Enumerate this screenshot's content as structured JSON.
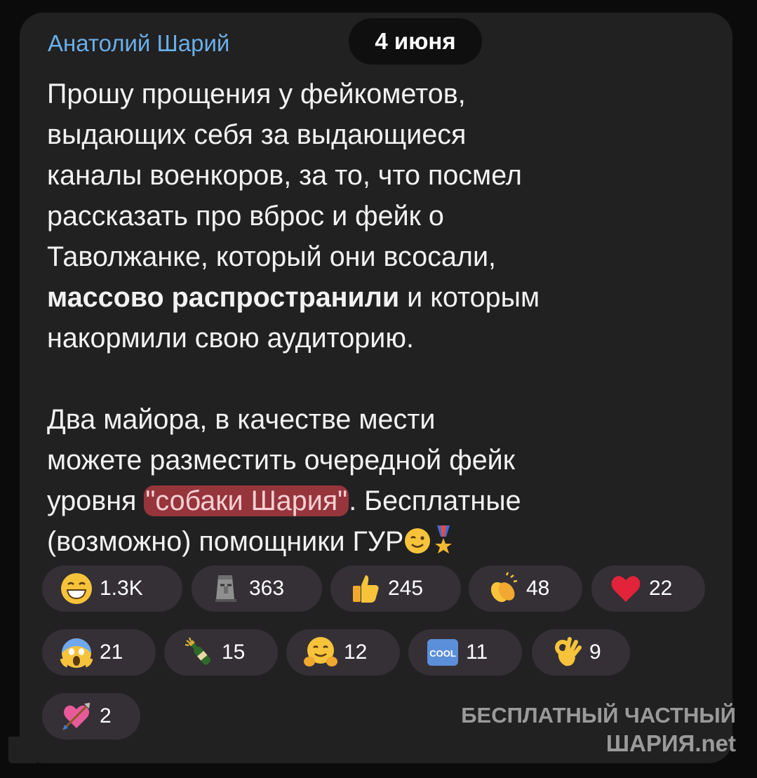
{
  "post": {
    "author": "Анатолий Шарий",
    "date": "4 июня",
    "p1_lines": [
      "Прошу прощения у фейкометов,",
      "выдающих себя за выдающиеся",
      "каналы военкоров, за то, что посмел",
      "рассказать про вброс и фейк о",
      "Таволжанке, который они всосали,"
    ],
    "p1_bold": "массово распространили",
    "p1_after_bold": " и которым",
    "p1_last": "накормили свою аудиторию.",
    "p2_lines": [
      "Два майора, в качестве мести",
      "можете разместить очередной фейк"
    ],
    "p2_before_hl": "уровня ",
    "p2_highlight": "\"собаки Шария\"",
    "p2_after_hl": ". Бесплатные",
    "p2_last": "(возможно) помощники ГУР"
  },
  "reactions": [
    {
      "emoji": "grinning-face",
      "count": "1.3K"
    },
    {
      "emoji": "moai",
      "count": "363"
    },
    {
      "emoji": "thumbs-up",
      "count": "245"
    },
    {
      "emoji": "clapping-hands",
      "count": "48"
    },
    {
      "emoji": "red-heart",
      "count": "22"
    },
    {
      "emoji": "screaming-face",
      "count": "21"
    },
    {
      "emoji": "champagne-bottle",
      "count": "15"
    },
    {
      "emoji": "hugging-face",
      "count": "12"
    },
    {
      "emoji": "cool-button",
      "count": "11"
    },
    {
      "emoji": "ok-hand",
      "count": "9"
    },
    {
      "emoji": "heart-with-arrow",
      "count": "2"
    }
  ],
  "watermark": {
    "line1": "БЕСПЛАТНЫЙ ЧАСТНЫЙ",
    "line2": "ШАРИЯ.net"
  },
  "colors": {
    "bubble": "#212121",
    "author": "#6aaeea",
    "reaction_pill": "#343036",
    "highlight": "#be3c46"
  }
}
